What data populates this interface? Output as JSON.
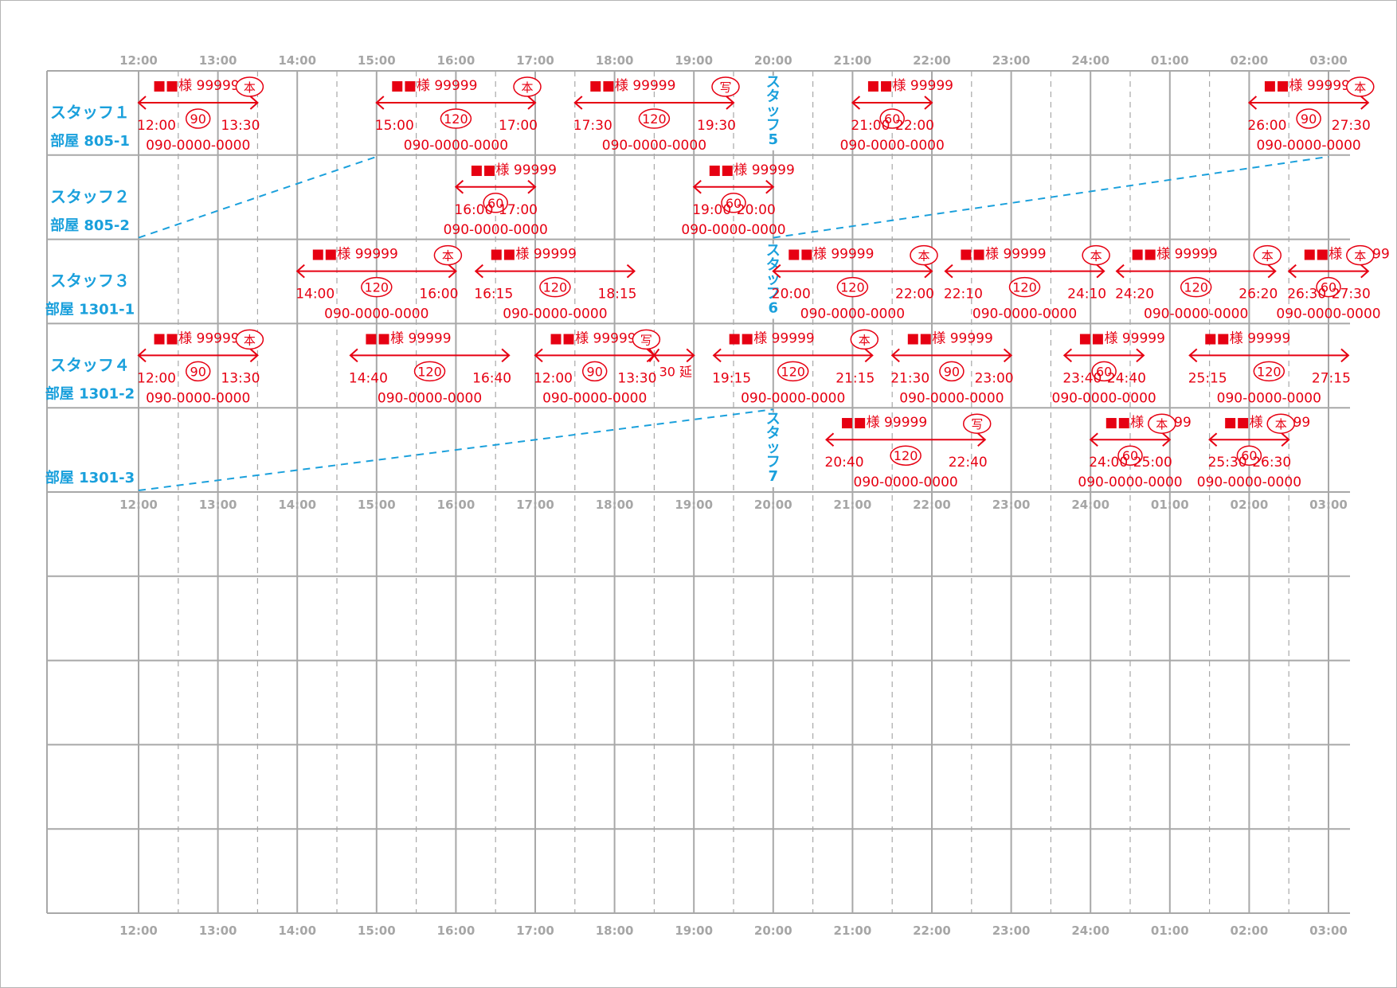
{
  "schedule": {
    "hours": [
      "12:00",
      "13:00",
      "14:00",
      "15:00",
      "16:00",
      "17:00",
      "18:00",
      "19:00",
      "20:00",
      "21:00",
      "22:00",
      "23:00",
      "24:00",
      "01:00",
      "02:00",
      "03:00"
    ],
    "total_rows": 10,
    "rows": [
      {
        "staff": "スタッフ１",
        "room": "部屋 805-1"
      },
      {
        "staff": "スタッフ２",
        "room": "部屋 805-2"
      },
      {
        "staff": "スタッフ３",
        "room": "部屋 1301-1"
      },
      {
        "staff": "スタッフ４",
        "room": "部屋 1301-2"
      },
      {
        "staff": "",
        "room": "部屋 1301-3"
      }
    ],
    "vertical_staff": [
      {
        "label": "スタッフ5",
        "row": 0
      },
      {
        "label": "スタッフ6",
        "row": 2
      },
      {
        "label": "スタッフ7",
        "row": 4
      }
    ],
    "transfers": [
      {
        "from_row": 1,
        "from_time": 12.0,
        "to_row": 0,
        "to_time": 15.0
      },
      {
        "from_row": 1,
        "from_time": 20.0,
        "to_row": 0,
        "to_time": 27.0
      },
      {
        "from_row": 4,
        "from_time": 12.0,
        "to_row": 3,
        "to_time": 20.0
      }
    ],
    "bookings": [
      {
        "row": 0,
        "start": 12.0,
        "end": 13.5,
        "name": "■■様",
        "id": "99999",
        "badge": "本",
        "start_label": "12:00",
        "end_label": "13:30",
        "duration": "90",
        "phone": "090-0000-0000"
      },
      {
        "row": 0,
        "start": 15.0,
        "end": 17.0,
        "name": "■■様",
        "id": "99999",
        "badge": "本",
        "start_label": "15:00",
        "end_label": "17:00",
        "duration": "120",
        "phone": "090-0000-0000"
      },
      {
        "row": 0,
        "start": 17.5,
        "end": 19.5,
        "name": "■■様",
        "id": "99999",
        "badge": "写",
        "start_label": "17:30",
        "end_label": "19:30",
        "duration": "120",
        "phone": "090-0000-0000"
      },
      {
        "row": 0,
        "start": 21.0,
        "end": 22.0,
        "name": "■■様",
        "id": "99999",
        "badge": "",
        "start_label": "21:00",
        "end_label": "22:00",
        "duration": "60",
        "phone": "090-0000-0000"
      },
      {
        "row": 0,
        "start": 26.0,
        "end": 27.5,
        "name": "■■様",
        "id": "99999",
        "badge": "本",
        "start_label": "26:00",
        "end_label": "27:30",
        "duration": "90",
        "phone": "090-0000-0000"
      },
      {
        "row": 1,
        "start": 16.0,
        "end": 17.0,
        "name": "■■様",
        "id": "99999",
        "badge": "",
        "start_label": "16:00",
        "end_label": "17:00",
        "duration": "60",
        "phone": "090-0000-0000"
      },
      {
        "row": 1,
        "start": 19.0,
        "end": 20.0,
        "name": "■■様",
        "id": "99999",
        "badge": "",
        "start_label": "19:00",
        "end_label": "20:00",
        "duration": "60",
        "phone": "090-0000-0000"
      },
      {
        "row": 2,
        "start": 14.0,
        "end": 16.0,
        "name": "■■様",
        "id": "99999",
        "badge": "本",
        "start_label": "14:00",
        "end_label": "16:00",
        "duration": "120",
        "phone": "090-0000-0000"
      },
      {
        "row": 2,
        "start": 16.25,
        "end": 18.25,
        "name": "■■様",
        "id": "99999",
        "badge": "",
        "start_label": "16:15",
        "end_label": "18:15",
        "duration": "120",
        "phone": "090-0000-0000"
      },
      {
        "row": 2,
        "start": 20.0,
        "end": 22.0,
        "name": "■■様",
        "id": "99999",
        "badge": "本",
        "start_label": "20:00",
        "end_label": "22:00",
        "duration": "120",
        "phone": "090-0000-0000"
      },
      {
        "row": 2,
        "start": 22.17,
        "end": 24.17,
        "name": "■■様",
        "id": "99999",
        "badge": "本",
        "start_label": "22:10",
        "end_label": "24:10",
        "duration": "120",
        "phone": "090-0000-0000"
      },
      {
        "row": 2,
        "start": 24.33,
        "end": 26.33,
        "name": "■■様",
        "id": "99999",
        "badge": "本",
        "start_label": "24:20",
        "end_label": "26:20",
        "duration": "120",
        "phone": "090-0000-0000"
      },
      {
        "row": 2,
        "start": 26.5,
        "end": 27.5,
        "name": "■■様",
        "id": "99999",
        "badge": "本",
        "start_label": "26:30",
        "end_label": "27:30",
        "duration": "60",
        "phone": "090-0000-0000"
      },
      {
        "row": 3,
        "start": 12.0,
        "end": 13.5,
        "name": "■■様",
        "id": "99999",
        "badge": "本",
        "start_label": "12:00",
        "end_label": "13:30",
        "duration": "90",
        "phone": "090-0000-0000"
      },
      {
        "row": 3,
        "start": 14.67,
        "end": 16.67,
        "name": "■■様",
        "id": "99999",
        "badge": "",
        "start_label": "14:40",
        "end_label": "16:40",
        "duration": "120",
        "phone": "090-0000-0000"
      },
      {
        "row": 3,
        "start": 17.0,
        "end": 18.5,
        "name": "■■様",
        "id": "99999",
        "badge": "写",
        "start_label": "12:00",
        "end_label": "13:30",
        "duration": "90",
        "phone": "090-0000-0000",
        "extension_end": 19.0,
        "extension_label": "30 延"
      },
      {
        "row": 3,
        "start": 19.25,
        "end": 21.25,
        "name": "■■様",
        "id": "99999",
        "badge": "本",
        "start_label": "19:15",
        "end_label": "21:15",
        "duration": "120",
        "phone": "090-0000-0000"
      },
      {
        "row": 3,
        "start": 21.5,
        "end": 23.0,
        "name": "■■様",
        "id": "99999",
        "badge": "",
        "start_label": "21:30",
        "end_label": "23:00",
        "duration": "90",
        "phone": "090-0000-0000"
      },
      {
        "row": 3,
        "start": 23.67,
        "end": 24.67,
        "name": "■■様",
        "id": "99999",
        "badge": "",
        "start_label": "23:40",
        "end_label": "24:40",
        "duration": "60",
        "phone": "090-0000-0000"
      },
      {
        "row": 3,
        "start": 25.25,
        "end": 27.25,
        "name": "■■様",
        "id": "99999",
        "badge": "",
        "start_label": "25:15",
        "end_label": "27:15",
        "duration": "120",
        "phone": "090-0000-0000"
      },
      {
        "row": 4,
        "start": 20.67,
        "end": 22.67,
        "name": "■■様",
        "id": "99999",
        "badge": "写",
        "start_label": "20:40",
        "end_label": "22:40",
        "duration": "120",
        "phone": "090-0000-0000"
      },
      {
        "row": 4,
        "start": 24.0,
        "end": 25.0,
        "name": "■■様",
        "id": "99999",
        "badge": "本",
        "start_label": "24:00",
        "end_label": "25:00",
        "duration": "60",
        "phone": "090-0000-0000"
      },
      {
        "row": 4,
        "start": 25.5,
        "end": 26.5,
        "name": "■■様",
        "id": "99999",
        "badge": "本",
        "start_label": "25:30",
        "end_label": "26:30",
        "duration": "60",
        "phone": "090-0000-0000"
      }
    ],
    "colors": {
      "booking": "#e60012",
      "staff": "#1aa0dc",
      "grid": "#a8a8a8",
      "time_label": "#a6a6a6"
    }
  }
}
